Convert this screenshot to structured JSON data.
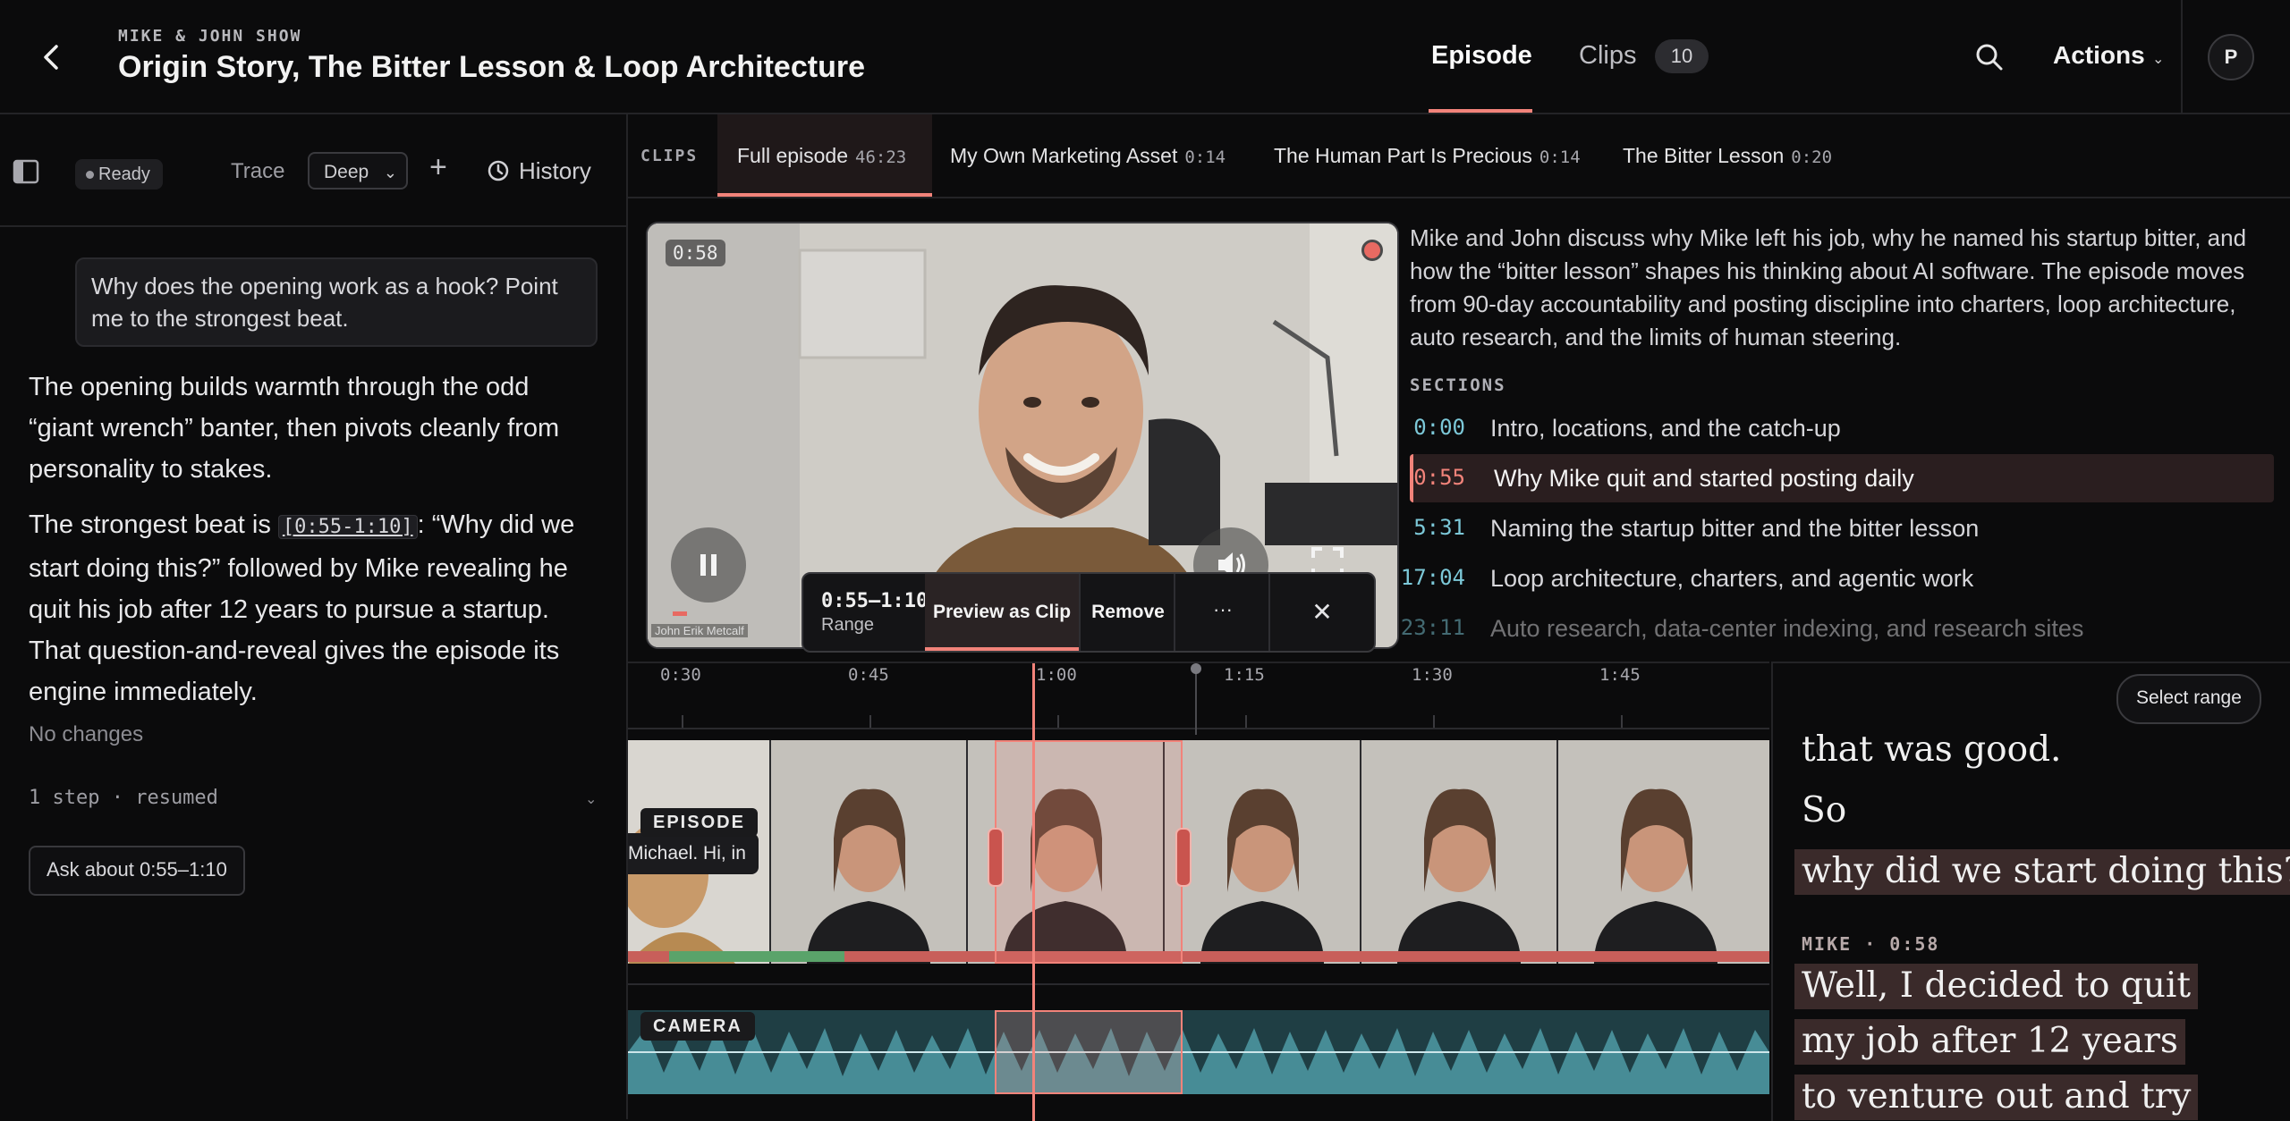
{
  "header": {
    "show_name": "MIKE & JOHN SHOW",
    "title": "Origin Story, The Bitter Lesson & Loop Architecture",
    "tabs": {
      "episode": "Episode",
      "clips": "Clips",
      "clips_count": "10"
    },
    "actions_label": "Actions",
    "avatar_initial": "P"
  },
  "assistant": {
    "status": "Ready",
    "trace_label": "Trace",
    "trace_depth": "Deep",
    "history_label": "History",
    "user_message": "Why does the opening work as a hook? Point me to the strongest beat.",
    "response_p1": "The opening builds warmth through the odd “giant wrench” banter, then pivots cleanly from personality to stakes.",
    "response_p2_pre": "The strongest beat is",
    "response_p2_ts": "[0:55-1:10]",
    "response_p2_post": ": “Why did we start doing this?” followed by Mike revealing he quit his job after 12 years to pursue a startup. That question-and-reveal gives the episode its engine immediately.",
    "no_changes": "No changes",
    "step_info": "1 step · resumed",
    "ask_button": "Ask about 0:55–1:10"
  },
  "clip_tabs": {
    "label": "CLIPS",
    "items": [
      {
        "name": "Full episode",
        "duration": "46:23"
      },
      {
        "name": "My Own Marketing Asset",
        "duration": "0:14"
      },
      {
        "name": "The Human Part Is Precious",
        "duration": "0:14"
      },
      {
        "name": "The Bitter Lesson",
        "duration": "0:20"
      }
    ]
  },
  "video": {
    "timestamp": "0:58",
    "progress": 0.021,
    "camera_label": "John Erik Metcalf",
    "range_popup": {
      "range": "0:55–1:10",
      "range_label": "Range",
      "preview_label": "Preview as Clip",
      "remove_label": "Remove",
      "more_label": "···",
      "close_label": "✕"
    }
  },
  "summary": "Mike and John discuss why Mike left his job, why he named his startup bitter, and how the “bitter lesson” shapes his thinking about AI software. The episode moves from 90-day accountability and posting discipline into charters, loop architecture, auto research, and the limits of human steering.",
  "sections": {
    "label": "SECTIONS",
    "items": [
      {
        "time": "0:00",
        "label": "Intro, locations, and the catch-up"
      },
      {
        "time": "0:55",
        "label": "Why Mike quit and started posting daily"
      },
      {
        "time": "5:31",
        "label": "Naming the startup bitter and the bitter lesson"
      },
      {
        "time": "17:04",
        "label": "Loop architecture, charters, and agentic work"
      },
      {
        "time": "23:11",
        "label": "Auto research, data-center indexing, and research sites"
      }
    ]
  },
  "timeline": {
    "ticks": [
      "0:30",
      "0:45",
      "1:00",
      "1:15",
      "1:30",
      "1:45"
    ],
    "episode_label": "EPISODE",
    "camera_label": "CAMERA",
    "caption_snippet": "Michael. Hi, in"
  },
  "transcript": {
    "select_range": "Select range",
    "lines_a": [
      "that was good.",
      "So",
      "why did we start doing this?"
    ],
    "speaker": "MIKE · 0:58",
    "lines_b": [
      "Well, I decided to quit",
      "my job after 12 years",
      "to venture out and try"
    ]
  },
  "colors": {
    "accent": "#f2837a",
    "timestamp": "#7cc8d8",
    "background": "#0b0b0c"
  }
}
